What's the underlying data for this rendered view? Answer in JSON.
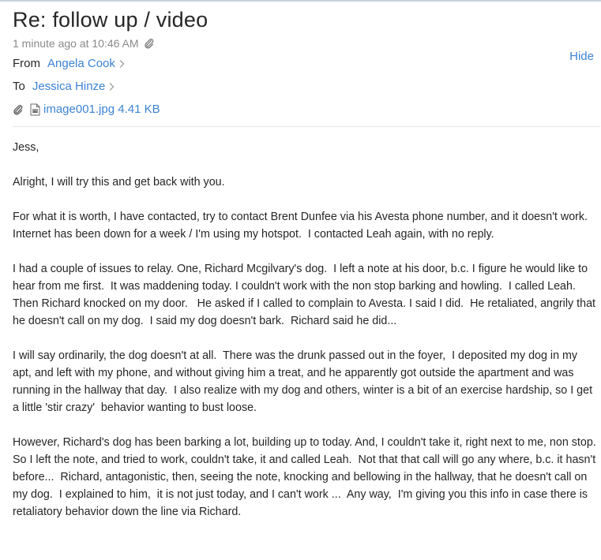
{
  "message": {
    "subject": "Re: follow up / video",
    "timestamp": "1 minute ago at 10:46 AM",
    "from_label": "From",
    "from_name": "Angela Cook",
    "to_label": "To",
    "to_name": "Jessica Hinze",
    "hide_label": "Hide",
    "attachment": "image001.jpg 4.41 KB",
    "icons": {
      "timestamp_attachment": "paperclip-icon",
      "attachment_row": "paperclip-icon",
      "attachment_file": "document-icon",
      "contact_disclosure": "chevron-right-icon"
    },
    "colors": {
      "link": "#3d83d4",
      "muted": "#8a8a8a",
      "text": "#262626"
    }
  },
  "body": {
    "paragraphs": [
      "Jess,",
      "Alright, I will try this and get back with you.",
      "For what it is worth, I have contacted, try to contact Brent Dunfee via his Avesta phone number, and it doesn't work.  Internet has been down for a week / I'm using my hotspot.  I contacted Leah again, with no reply.",
      "I had a couple of issues to relay. One, Richard Mcgilvary's dog.  I left a note at his door, b.c. I figure he would like to  hear from me first.  It was maddening today. I couldn't work with the non stop barking and howling.  I called Leah.   Then Richard knocked on my door.   He asked if I called to complain to Avesta. I said I did.  He retaliated, angrily that he doesn't call on my dog.  I said my dog doesn't bark.  Richard said he did...",
      "I will say ordinarily, the dog doesn't at all.  There was the drunk passed out in the foyer,  I deposited my dog in my apt, and left with my phone, and without giving him a treat, and he apparently got outside the apartment and was running in the hallway that day.  I also realize with my dog and others, winter is a bit of an exercise hardship, so I get a little 'stir crazy'  behavior wanting to bust loose.",
      "However, Richard's dog has been barking a lot, building up to today. And, I couldn't take it, right next to me, non stop.  So I left the note, and tried to work, couldn't take, it and called Leah.  Not that that call will go any where, b.c. it hasn't before...  Richard, antagonistic, then, seeing the note, knocking and bellowing in the hallway, that he doesn't call on my dog.  I explained to him,  it is not just today, and I can't work ...  Any way,  I'm giving you this info in case there is retaliatory behavior down the line via Richard."
    ]
  }
}
